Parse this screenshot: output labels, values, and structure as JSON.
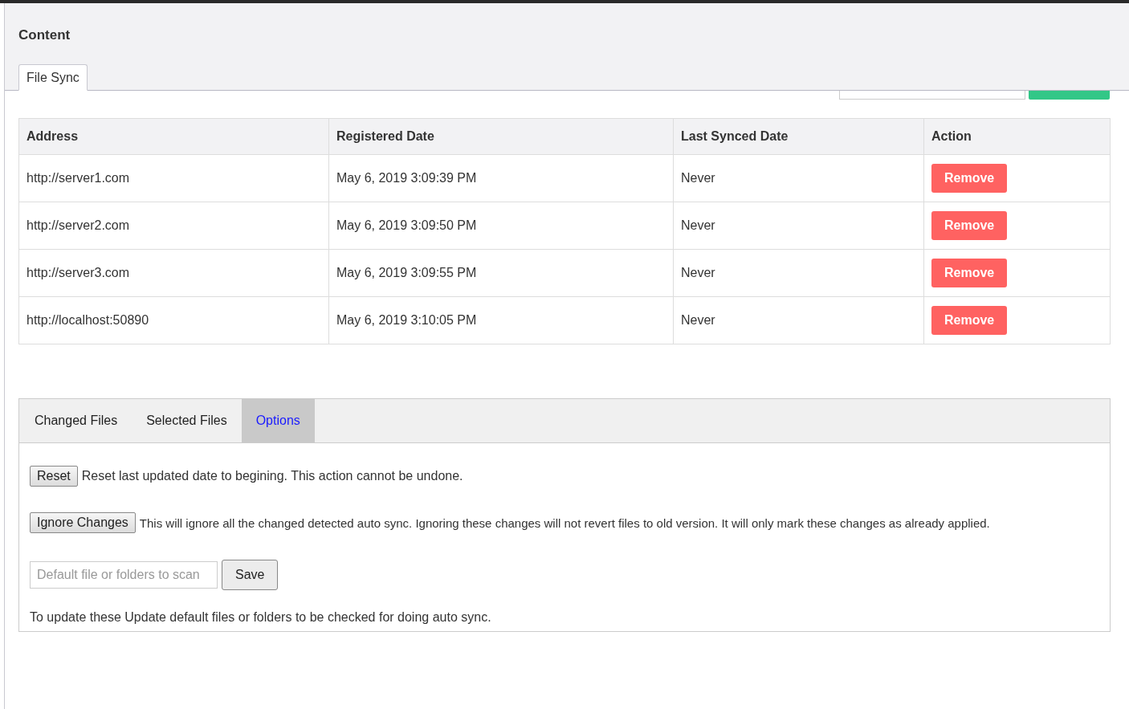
{
  "page": {
    "title": "Content"
  },
  "tabs": [
    {
      "label": "File Sync",
      "selected": true
    }
  ],
  "table": {
    "columns": [
      "Address",
      "Registered Date",
      "Last Synced Date",
      "Action"
    ],
    "rows": [
      {
        "address": "http://server1.com",
        "registered": "May 6, 2019 3:09:39 PM",
        "last_synced": "Never",
        "action": "Remove"
      },
      {
        "address": "http://server2.com",
        "registered": "May 6, 2019 3:09:50 PM",
        "last_synced": "Never",
        "action": "Remove"
      },
      {
        "address": "http://server3.com",
        "registered": "May 6, 2019 3:09:55 PM",
        "last_synced": "Never",
        "action": "Remove"
      },
      {
        "address": "http://localhost:50890",
        "registered": "May 6, 2019 3:10:05 PM",
        "last_synced": "Never",
        "action": "Remove"
      }
    ]
  },
  "panel_tabs": [
    {
      "label": "Changed Files",
      "selected": false
    },
    {
      "label": "Selected Files",
      "selected": false
    },
    {
      "label": "Options",
      "selected": true
    }
  ],
  "options": {
    "reset": {
      "button": "Reset",
      "text": "Reset last updated date to begining. This action cannot be undone."
    },
    "ignore": {
      "button": "Ignore Changes",
      "text": "This will ignore all the changed detected auto sync. Ignoring these changes will not revert files to old version. It will only mark these changes as already applied."
    },
    "scan": {
      "placeholder": "Default file or folders to scan",
      "button": "Save"
    },
    "note": "To update these Update default files or folders to be checked for doing auto sync."
  }
}
